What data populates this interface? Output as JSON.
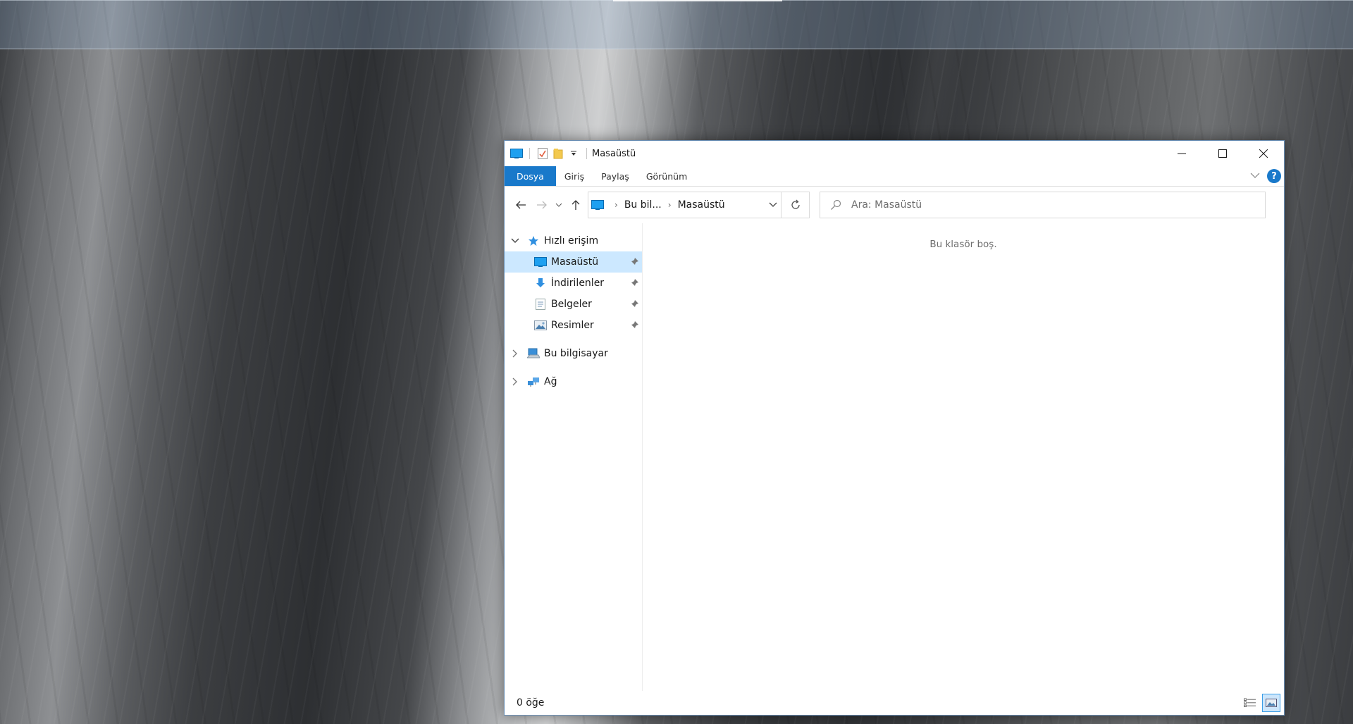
{
  "window": {
    "title": "Masaüstü"
  },
  "ribbon": {
    "tabs": [
      "Dosya",
      "Giriş",
      "Paylaş",
      "Görünüm"
    ],
    "help_label": "?"
  },
  "address": {
    "crumbs": [
      "Bu bil...",
      "Masaüstü"
    ]
  },
  "search": {
    "placeholder": "Ara: Masaüstü"
  },
  "navpane": {
    "quick_access_label": "Hızlı erişim",
    "items": [
      {
        "label": "Masaüstü",
        "icon": "desktop-icon",
        "pinned": true,
        "selected": true
      },
      {
        "label": "İndirilenler",
        "icon": "downloads-icon",
        "pinned": true
      },
      {
        "label": "Belgeler",
        "icon": "documents-icon",
        "pinned": true
      },
      {
        "label": "Resimler",
        "icon": "pictures-icon",
        "pinned": true
      }
    ],
    "this_pc_label": "Bu bilgisayar",
    "network_label": "Ağ"
  },
  "main": {
    "empty_message": "Bu klasör boş."
  },
  "status": {
    "item_count": "0 öğe"
  },
  "colors": {
    "accent": "#1979ca",
    "selection": "#cce8ff"
  }
}
